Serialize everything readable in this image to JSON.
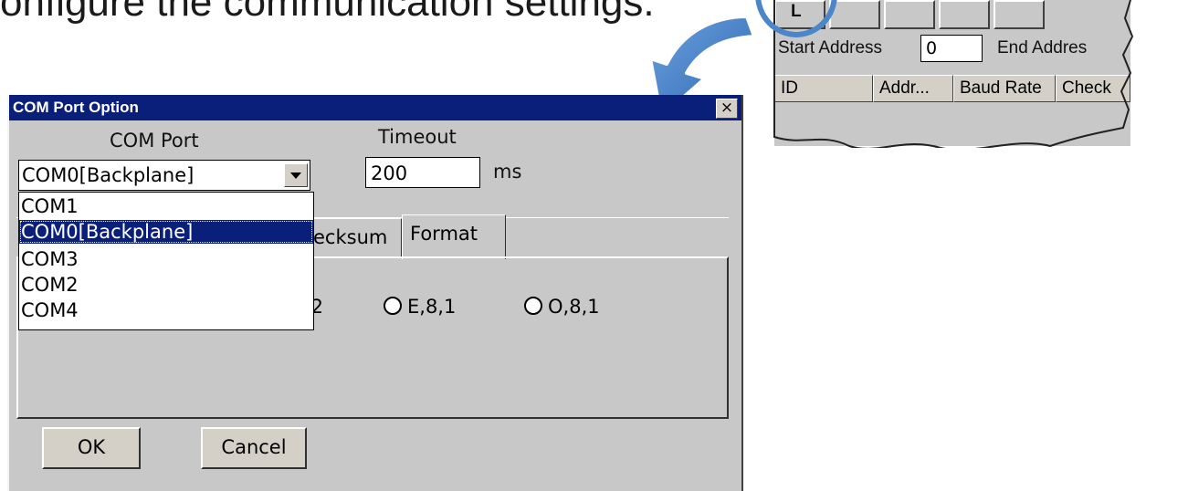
{
  "instruction": "onfigure the communication settings.",
  "dialog": {
    "title": "COM Port Option",
    "close_label": "×",
    "com_port_label": "COM Port",
    "com_port_value": "COM0[Backplane]",
    "com_port_options": [
      "COM1",
      "COM0[Backplane]",
      "COM3",
      "COM2",
      "COM4"
    ],
    "timeout_label": "Timeout",
    "timeout_value": "200",
    "timeout_unit": "ms",
    "tabs": [
      "ecksum",
      "Format"
    ],
    "radio_options": [
      ",2",
      "E,8,1",
      "O,8,1"
    ],
    "ok_label": "OK",
    "cancel_label": "Cancel"
  },
  "inset": {
    "start_address_label": "Start Address",
    "start_address_value": "0",
    "end_address_label": "End Addres",
    "columns": [
      "ID",
      "Addr...",
      "Baud Rate",
      "Check"
    ],
    "toolbar_first_label": "L"
  },
  "colors": {
    "titlebar": "#0a1f7a",
    "dialog_bg": "#c8c8c8",
    "arrow_blue": "#3a78c4",
    "highlight_circle": "#4a86c8"
  }
}
